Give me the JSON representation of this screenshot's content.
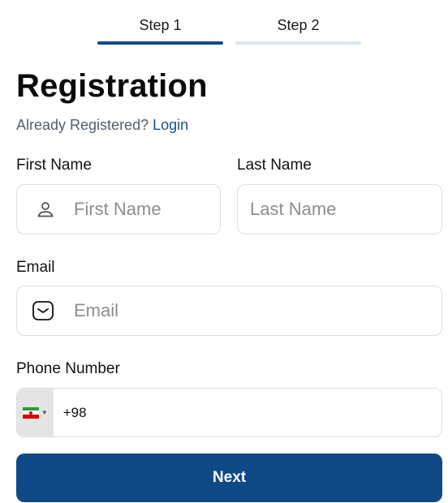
{
  "steps": [
    {
      "label": "Step 1",
      "active": true
    },
    {
      "label": "Step 2",
      "active": false
    }
  ],
  "title": "Registration",
  "already_registered": {
    "text": "Already Registered?",
    "link_label": "Login"
  },
  "form": {
    "first_name": {
      "label": "First Name",
      "placeholder": "First Name",
      "value": "",
      "icon": "user-icon"
    },
    "last_name": {
      "label": "Last Name",
      "placeholder": "Last Name",
      "value": ""
    },
    "email": {
      "label": "Email",
      "placeholder": "Email",
      "value": "",
      "icon": "mail-icon"
    },
    "phone": {
      "label": "Phone Number",
      "country_flag": "iran-flag-icon",
      "value": "+98"
    }
  },
  "next_button": {
    "label": "Next"
  },
  "colors": {
    "primary": "#0f4a86",
    "link": "#174f8c",
    "step_inactive": "#dde6f1",
    "border": "#dcdfe4"
  }
}
